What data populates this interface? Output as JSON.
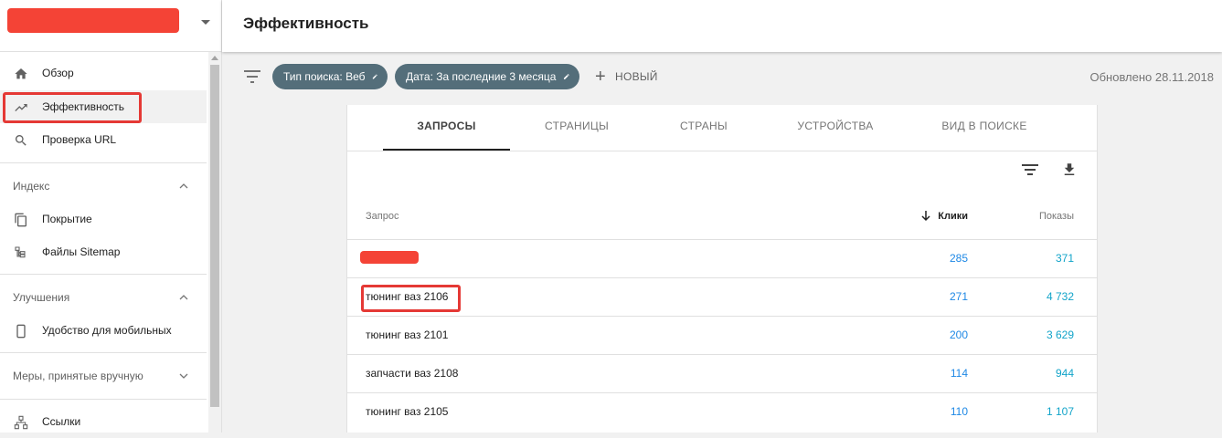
{
  "colors": {
    "redaction": "#f44336",
    "highlight": "#e53935",
    "chip_bg": "#546e7a",
    "clicks": "#1e88e5",
    "impressions": "#12a4c9"
  },
  "sidebar": {
    "property_name": "",
    "items_top": [
      {
        "label": "Обзор",
        "icon": "home-icon"
      },
      {
        "label": "Эффективность",
        "icon": "trending-up-icon"
      },
      {
        "label": "Проверка URL",
        "icon": "search-icon"
      }
    ],
    "sections": [
      {
        "title": "Индекс",
        "items": [
          {
            "label": "Покрытие",
            "icon": "copy-pages-icon"
          },
          {
            "label": "Файлы Sitemap",
            "icon": "sitemap-icon"
          }
        ]
      },
      {
        "title": "Улучшения",
        "items": [
          {
            "label": "Удобство для мобильных",
            "icon": "smartphone-icon"
          }
        ]
      },
      {
        "title": "Меры, принятые вручную",
        "items": []
      }
    ],
    "bottom_item": {
      "label": "Ссылки",
      "icon": "links-tree-icon"
    }
  },
  "header": {
    "title": "Эффективность"
  },
  "filters": {
    "chips": [
      {
        "label": "Тип поиска: Веб"
      },
      {
        "label": "Дата: За последние 3 месяца"
      }
    ],
    "new_label": "НОВЫЙ",
    "updated": "Обновлено 28.11.2018"
  },
  "tabs": [
    "ЗАПРОСЫ",
    "СТРАНИЦЫ",
    "СТРАНЫ",
    "УСТРОЙСТВА",
    "ВИД В ПОИСКЕ"
  ],
  "table": {
    "columns": {
      "query": "Запрос",
      "clicks": "Клики",
      "impressions": "Показы"
    },
    "rows": [
      {
        "query": "",
        "clicks": "285",
        "impressions": "371"
      },
      {
        "query": "тюнинг ваз 2106",
        "clicks": "271",
        "impressions": "4 732"
      },
      {
        "query": "тюнинг ваз 2101",
        "clicks": "200",
        "impressions": "3 629"
      },
      {
        "query": "запчасти ваз 2108",
        "clicks": "114",
        "impressions": "944"
      },
      {
        "query": "тюнинг ваз 2105",
        "clicks": "110",
        "impressions": "1 107"
      }
    ]
  }
}
